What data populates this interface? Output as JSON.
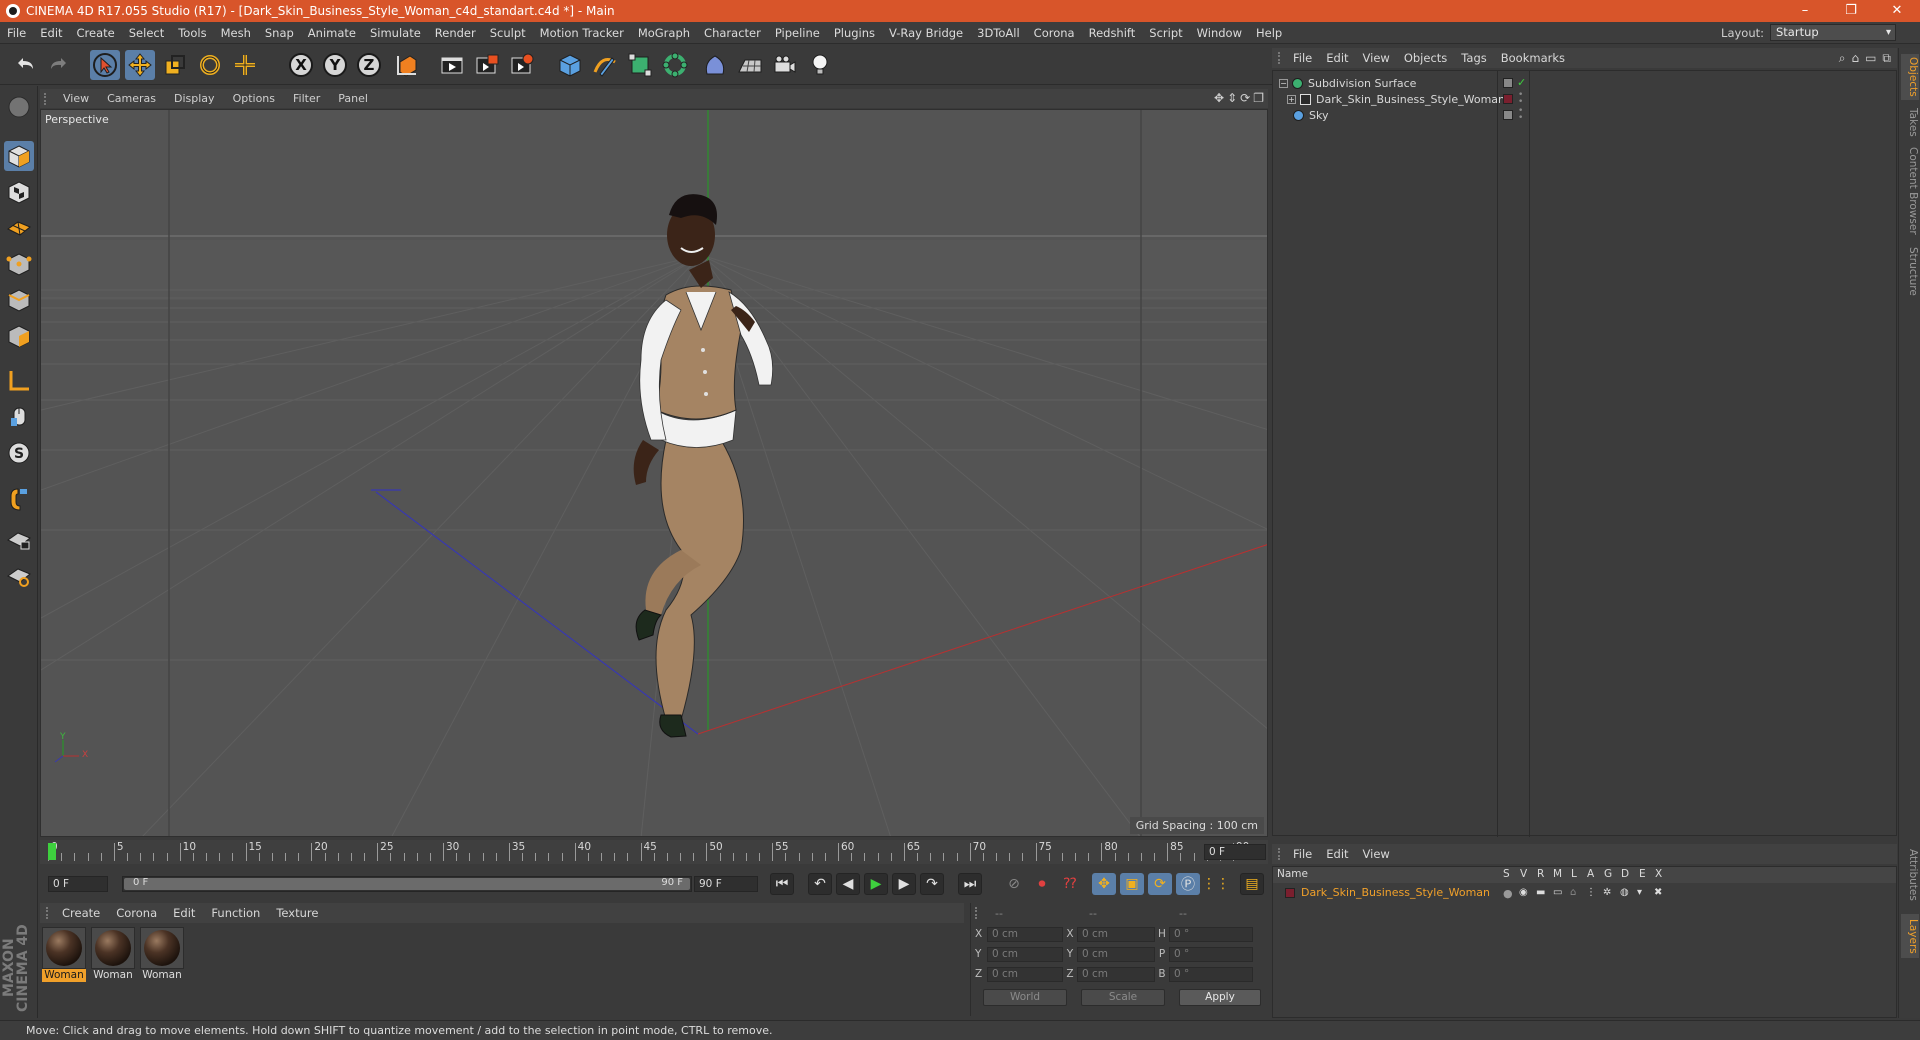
{
  "window": {
    "title": "CINEMA 4D R17.055 Studio (R17) - [Dark_Skin_Business_Style_Woman_c4d_standart.c4d *] - Main",
    "controls": [
      "–",
      "❐",
      "✕"
    ]
  },
  "menubar": {
    "items": [
      "File",
      "Edit",
      "Create",
      "Select",
      "Tools",
      "Mesh",
      "Snap",
      "Animate",
      "Simulate",
      "Render",
      "Sculpt",
      "Motion Tracker",
      "MoGraph",
      "Character",
      "Pipeline",
      "Plugins",
      "V-Ray Bridge",
      "3DToAll",
      "Corona",
      "Redshift",
      "Script",
      "Window",
      "Help"
    ],
    "layout_label": "Layout:",
    "layout_value": "Startup"
  },
  "toolbar": {
    "axis_x": "X",
    "axis_y": "Y",
    "axis_z": "Z",
    "icons": [
      "undo-icon",
      "redo-icon",
      "select-arrow-icon",
      "move-icon",
      "scale-icon",
      "rotate-icon",
      "live-selection-icon",
      "x-axis-icon",
      "y-axis-icon",
      "z-axis-icon",
      "coordinate-system-icon",
      "render-view-icon",
      "render-picture-viewer-icon",
      "render-settings-icon",
      "cube-icon",
      "pen-icon",
      "subdivision-icon",
      "array-icon",
      "deformer-icon",
      "floor-icon",
      "camera-icon",
      "light-icon"
    ]
  },
  "viewport": {
    "menu": [
      "View",
      "Cameras",
      "Display",
      "Options",
      "Filter",
      "Panel"
    ],
    "label": "Perspective",
    "grid_spacing": "Grid Spacing : 100 cm",
    "axis_y": "Y",
    "axis_x": "X"
  },
  "timeline": {
    "ticks": [
      "0",
      "5",
      "10",
      "15",
      "20",
      "25",
      "30",
      "35",
      "40",
      "45",
      "50",
      "55",
      "60",
      "65",
      "70",
      "75",
      "80",
      "85",
      "90"
    ],
    "current_frame": "0 F"
  },
  "transport": {
    "start_frame": "0 F",
    "range_start": "0 F",
    "range_end": "90 F",
    "end_frame": "90 F"
  },
  "material_manager": {
    "menu": [
      "Create",
      "Corona",
      "Edit",
      "Function",
      "Texture"
    ],
    "materials": [
      {
        "name": "Woman",
        "selected": true
      },
      {
        "name": "Woman",
        "selected": false
      },
      {
        "name": "Woman",
        "selected": false
      }
    ]
  },
  "coordinates": {
    "header": [
      "--",
      "--",
      "--"
    ],
    "rows": [
      {
        "a": "X",
        "av": "0 cm",
        "b": "X",
        "bv": "0 cm",
        "c": "H",
        "cv": "0 °"
      },
      {
        "a": "Y",
        "av": "0 cm",
        "b": "Y",
        "bv": "0 cm",
        "c": "P",
        "cv": "0 °"
      },
      {
        "a": "Z",
        "av": "0 cm",
        "b": "Z",
        "bv": "0 cm",
        "c": "B",
        "cv": "0 °"
      }
    ],
    "world": "World",
    "scale": "Scale",
    "apply": "Apply"
  },
  "object_manager": {
    "menu": [
      "File",
      "Edit",
      "View",
      "Objects",
      "Tags",
      "Bookmarks"
    ],
    "objects": [
      {
        "name": "Subdivision Surface",
        "indent": 0
      },
      {
        "name": "Dark_Skin_Business_Style_Woman",
        "indent": 1
      },
      {
        "name": "Sky",
        "indent": 0
      }
    ]
  },
  "layer_manager": {
    "menu": [
      "File",
      "Edit",
      "View"
    ],
    "name_header": "Name",
    "flags": [
      "S",
      "V",
      "R",
      "M",
      "L",
      "A",
      "G",
      "D",
      "E",
      "X"
    ],
    "layer_name": "Dark_Skin_Business_Style_Woman",
    "layer_color": "#7a1f2e"
  },
  "right_tabs": [
    "Objects",
    "Takes",
    "Content Browser",
    "Structure",
    "Attributes",
    "Layers"
  ],
  "brand": "MAXON CINEMA 4D",
  "status": "Move: Click and drag to move elements. Hold down SHIFT to quantize movement / add to the selection in point mode, CTRL to remove.",
  "colors": {
    "title_bar": "#d8552a",
    "selection_blue": "#5b7fa8",
    "accent_orange": "#f0a02a"
  }
}
